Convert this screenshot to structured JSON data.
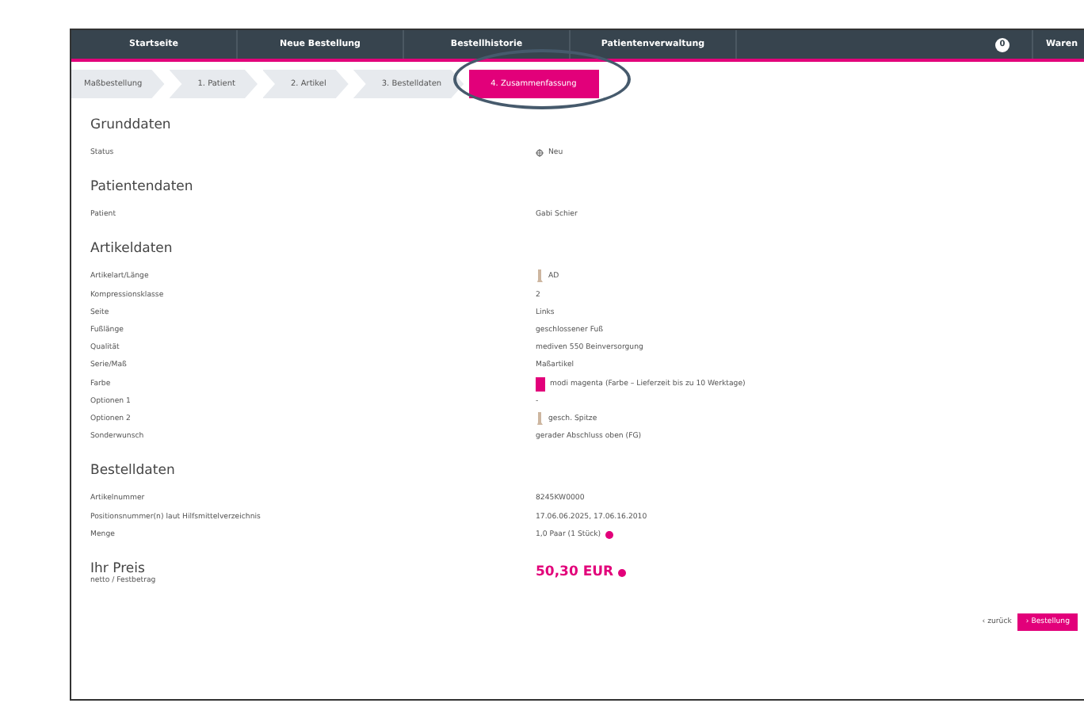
{
  "nav": {
    "items": [
      {
        "label": "Startseite"
      },
      {
        "label": "Neue Bestellung"
      },
      {
        "label": "Bestellhistorie"
      },
      {
        "label": "Patientenverwaltung"
      }
    ],
    "cart_count": "0",
    "cart_label": "Waren"
  },
  "steps": [
    {
      "label": "Maßbestellung",
      "selected": false
    },
    {
      "label": "1. Patient",
      "selected": false
    },
    {
      "label": "2. Artikel",
      "selected": false
    },
    {
      "label": "3. Bestelldaten",
      "selected": false
    },
    {
      "label": "4. Zusammenfassung",
      "selected": true
    }
  ],
  "sections": [
    {
      "title": "Grunddaten",
      "rows": [
        {
          "label": "Status",
          "value": "Neu",
          "kind": "status"
        }
      ]
    },
    {
      "title": "Patientendaten",
      "rows": [
        {
          "label": "Patient",
          "value": "Gabi Schier",
          "kind": "plain"
        }
      ]
    },
    {
      "title": "Artikeldaten",
      "rows": [
        {
          "label": "Artikelart/Länge",
          "value": "AD",
          "kind": "image"
        },
        {
          "label": "Kompressionsklasse",
          "value": "2",
          "kind": "plain"
        },
        {
          "label": "Seite",
          "value": "Links",
          "kind": "plain"
        },
        {
          "label": "Fußlänge",
          "value": "geschlossener Fuß",
          "kind": "plain"
        },
        {
          "label": "Qualität",
          "value": "mediven 550 Beinversorgung",
          "kind": "plain"
        },
        {
          "label": "Serie/Maß",
          "value": "Maßartikel",
          "kind": "plain"
        },
        {
          "label": "Farbe",
          "value": "modi magenta (Farbe – Lieferzeit bis zu 10 Werktage)",
          "kind": "swatch",
          "color": "#e2007a"
        },
        {
          "label": "Optionen 1",
          "value": "-",
          "kind": "plain"
        },
        {
          "label": "Optionen 2",
          "value": "gesch. Spitze",
          "kind": "image"
        },
        {
          "label": "Sonderwunsch",
          "value": "gerader Abschluss oben (FG)",
          "kind": "plain"
        }
      ]
    },
    {
      "title": "Bestelldaten",
      "rows": [
        {
          "label": "Artikelnummer",
          "value": "8245KW0000",
          "kind": "plain"
        },
        {
          "label": "Positionsnummer(n) laut Hilfsmittelverzeichnis",
          "value": "17.06.06.2025, 17.06.16.2010",
          "kind": "plain"
        },
        {
          "label": "Menge",
          "value": "1,0 Paar (1 Stück)",
          "kind": "info"
        }
      ]
    }
  ],
  "price": {
    "title": "Ihr Preis",
    "subtitle": "netto / Festbetrag",
    "value": "50,30 EUR"
  },
  "buttons": [
    {
      "label": "‹ zurück",
      "kind": "link"
    },
    {
      "label": "› Bestellung",
      "kind": "primary"
    }
  ]
}
